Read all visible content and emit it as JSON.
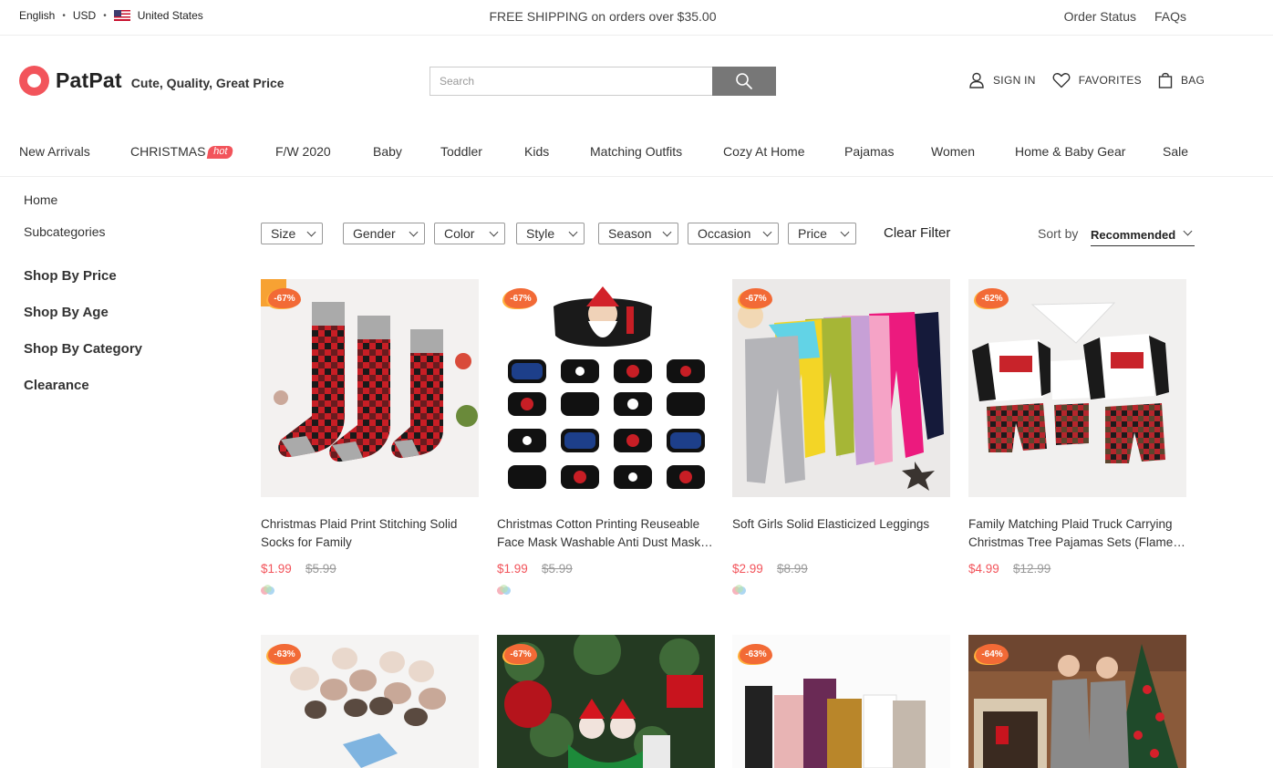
{
  "topbar": {
    "language": "English",
    "currency": "USD",
    "country": "United States",
    "shipping_notice": "FREE SHIPPING on orders over $35.00",
    "order_status": "Order Status",
    "faqs": "FAQs"
  },
  "header": {
    "brand": "PatPat",
    "tagline": "Cute, Quality, Great Price",
    "search_placeholder": "Search",
    "sign_in": "SIGN IN",
    "favorites": "FAVORITES",
    "bag": "BAG"
  },
  "nav": {
    "items": [
      "New Arrivals",
      "CHRISTMAS",
      "F/W 2020",
      "Baby",
      "Toddler",
      "Kids",
      "Matching Outfits",
      "Cozy At Home",
      "Pajamas",
      "Women",
      "Home & Baby Gear",
      "Sale"
    ],
    "hot_badge": "hot"
  },
  "sidebar": {
    "home": "Home",
    "subcategories": "Subcategories",
    "sections": [
      "Shop By Price",
      "Shop By Age",
      "Shop By Category",
      "Clearance"
    ]
  },
  "filters": {
    "buttons": [
      "Size",
      "Gender",
      "Color",
      "Style",
      "Season",
      "Occasion",
      "Price"
    ],
    "clear": "Clear Filter",
    "sort_label": "Sort by",
    "sort_value": "Recommended"
  },
  "products": [
    {
      "discount": "-67%",
      "title": "Christmas Plaid Print Stitching Solid Socks for Family",
      "price": "$1.99",
      "original_price": "$5.99"
    },
    {
      "discount": "-67%",
      "title": "Christmas Cotton Printing Reuseable Face Mask Washable Anti Dust Mask Mouth Mask for Adults and Kids",
      "price": "$1.99",
      "original_price": "$5.99"
    },
    {
      "discount": "-67%",
      "title": "Soft Girls Solid Elasticized Leggings",
      "price": "$2.99",
      "original_price": "$8.99"
    },
    {
      "discount": "-62%",
      "title": "Family Matching Plaid Truck Carrying Christmas Tree Pajamas Sets (Flame Resistant)",
      "price": "$4.99",
      "original_price": "$12.99"
    },
    {
      "discount": "-63%"
    },
    {
      "discount": "-67%"
    },
    {
      "discount": "-63%"
    },
    {
      "discount": "-64%"
    }
  ],
  "colors": {
    "accent": "#f2545b",
    "badge": "#f26a36",
    "search_button": "#777777"
  }
}
